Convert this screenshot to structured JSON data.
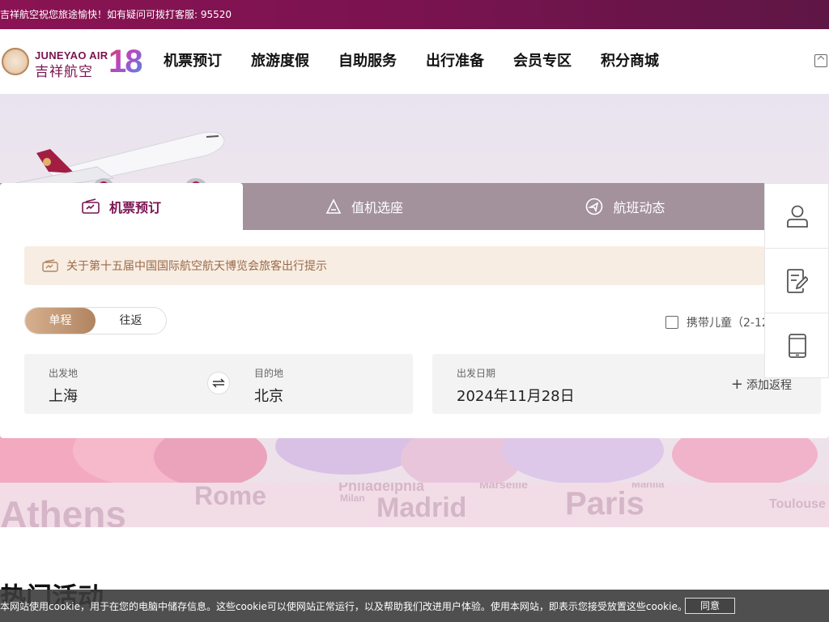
{
  "topbar": {
    "message": "吉祥航空祝您旅途愉快！如有疑问可拨打客服: 95520"
  },
  "header": {
    "logo_en": "JUNEYAO AIR",
    "logo_cn": "吉祥航空",
    "logo_badge": "18",
    "nav": [
      "机票预订",
      "旅游度假",
      "自助服务",
      "出行准备",
      "会员专区",
      "积分商城"
    ]
  },
  "booking": {
    "tabs": [
      {
        "label": "机票预订",
        "icon": "ticket-icon",
        "active": true
      },
      {
        "label": "值机选座",
        "icon": "seat-icon",
        "active": false
      },
      {
        "label": "航班动态",
        "icon": "flight-status-icon",
        "active": false
      }
    ],
    "notice": "关于第十五届中国国际航空航天博览会旅客出行提示",
    "trip_types": [
      "单程",
      "往返"
    ],
    "child_option": "携带儿童（2-12",
    "origin_label": "出发地",
    "origin_value": "上海",
    "destination_label": "目的地",
    "destination_value": "北京",
    "date_label": "出发日期",
    "date_value": "2024年11月28日",
    "add_return": "添加返程"
  },
  "side_tools": [
    "user-icon",
    "edit-note-icon",
    "mobile-icon"
  ],
  "hero": {
    "cities": [
      "Athens",
      "Rome",
      "Philadelphia",
      "Marseille",
      "Madrid",
      "Paris",
      "Milan",
      "Manila",
      "Toulouse"
    ]
  },
  "section": {
    "title": "热门活动"
  },
  "cookie": {
    "text": "本网站使用cookie，用于在您的电脑中储存信息。这些cookie可以使网站正常运行，以及帮助我们改进用户体验。使用本网站，即表示您接受放置这些cookie。",
    "accept": "同意"
  },
  "colors": {
    "brand": "#7a1350",
    "accent": "#b08460",
    "tab_inactive": "#a3919c"
  }
}
